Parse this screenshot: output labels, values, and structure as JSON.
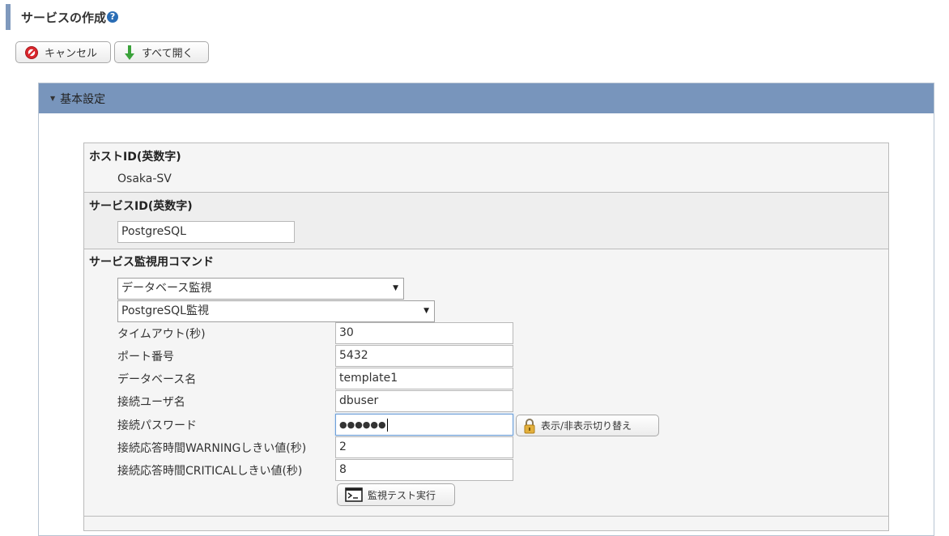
{
  "header": {
    "title": "サービスの作成",
    "help_icon": "?"
  },
  "toolbar": {
    "cancel_label": "キャンセル",
    "open_all_label": "すべて開く"
  },
  "panel": {
    "title": "基本設定"
  },
  "form": {
    "host_id_label": "ホストID(英数字)",
    "host_id_value": "Osaka-SV",
    "service_id_label": "サービスID(英数字)",
    "service_id_value": "PostgreSQL",
    "command_label": "サービス監視用コマンド",
    "command_category": "データベース監視",
    "command_type": "PostgreSQL監視",
    "params": [
      {
        "label": "タイムアウト(秒)",
        "value": "30"
      },
      {
        "label": "ポート番号",
        "value": "5432"
      },
      {
        "label": "データベース名",
        "value": "template1"
      },
      {
        "label": "接続ユーザ名",
        "value": "dbuser"
      },
      {
        "label": "接続パスワード",
        "value": "●●●●●●"
      },
      {
        "label": "接続応答時間WARNINGしきい値(秒)",
        "value": "2"
      },
      {
        "label": "接続応答時間CRITICALしきい値(秒)",
        "value": "8"
      }
    ],
    "toggle_password_label": "表示/非表示切り替え",
    "test_button_label": "監視テスト実行"
  },
  "colors": {
    "panel_header": "#7895bc",
    "header_accent": "#7f99bd",
    "help_icon": "#2a6db5"
  }
}
